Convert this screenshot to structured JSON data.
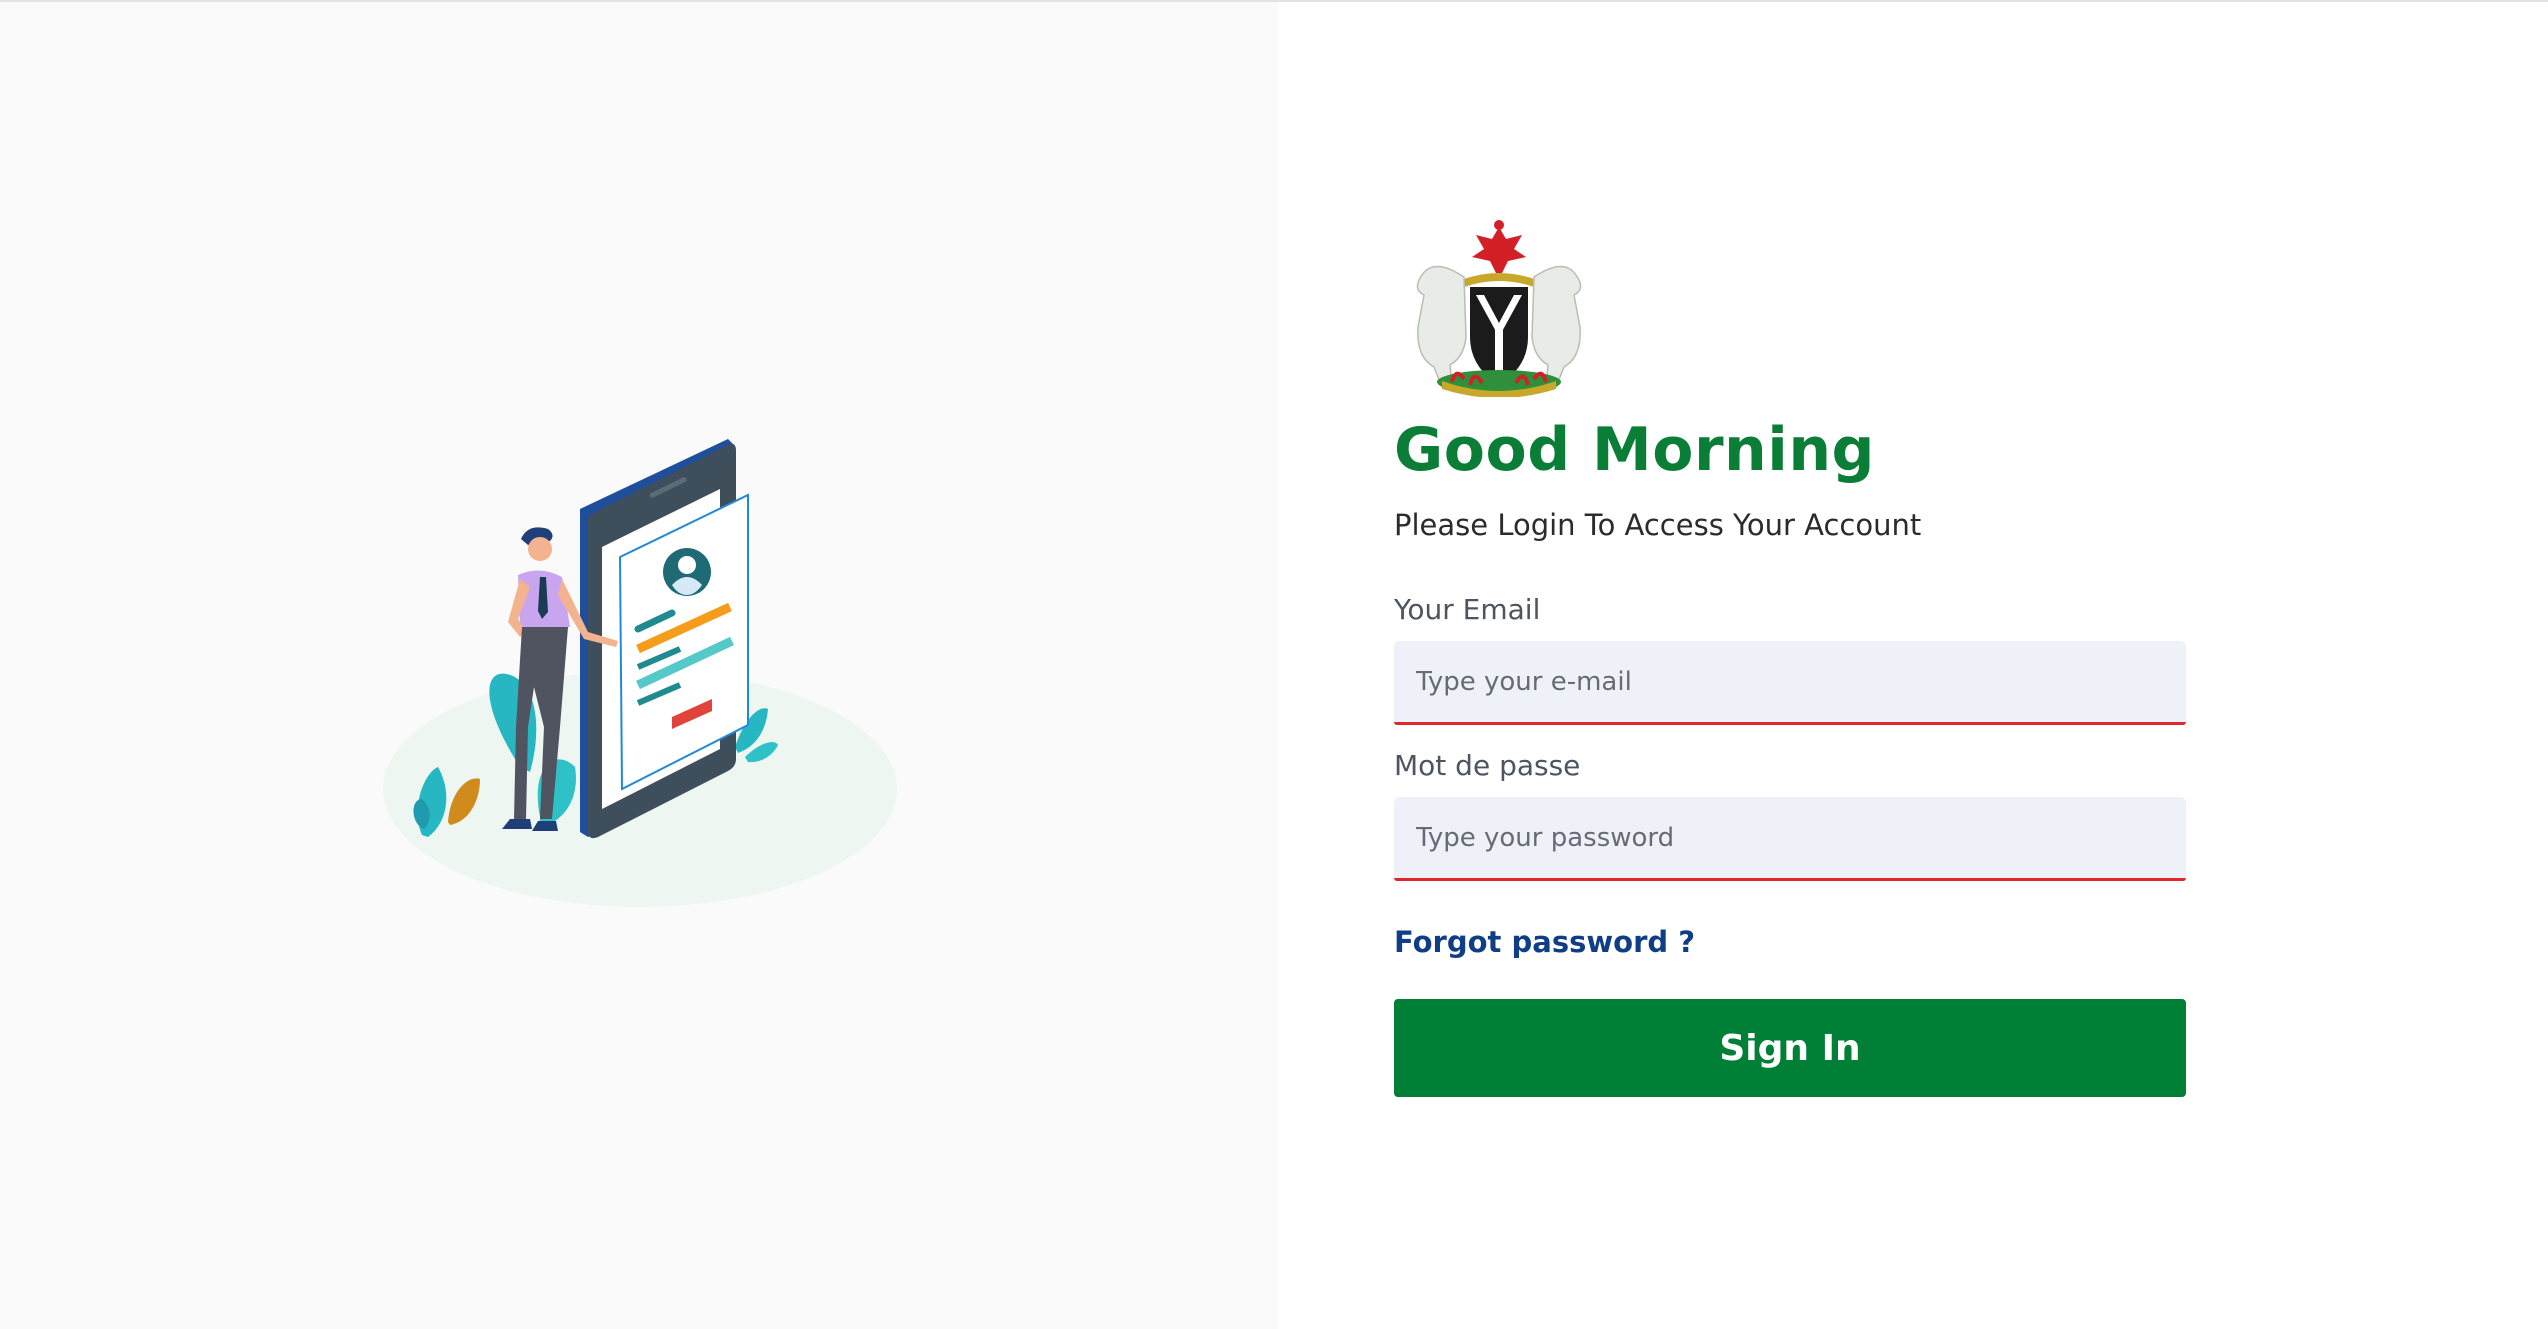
{
  "login": {
    "greeting": "Good Morning",
    "subtitle": "Please Login To Access Your Account",
    "email_label": "Your Email",
    "email_placeholder": "Type your e-mail",
    "email_value": "",
    "password_label": "Mot de passe",
    "password_placeholder": "Type your password",
    "password_value": "",
    "forgot_password": "Forgot password ?",
    "sign_in": "Sign In"
  },
  "colors": {
    "brand_green": "#007f36",
    "greeting_green": "#0a7d36",
    "link_blue": "#0f3e86",
    "input_error_border": "#e0272b",
    "input_background": "#eef1f8",
    "left_panel_background": "#fafafa"
  },
  "icons": {
    "coat_of_arms": "nigeria-coat-of-arms-icon",
    "illustration": "phone-profile-illustration"
  }
}
